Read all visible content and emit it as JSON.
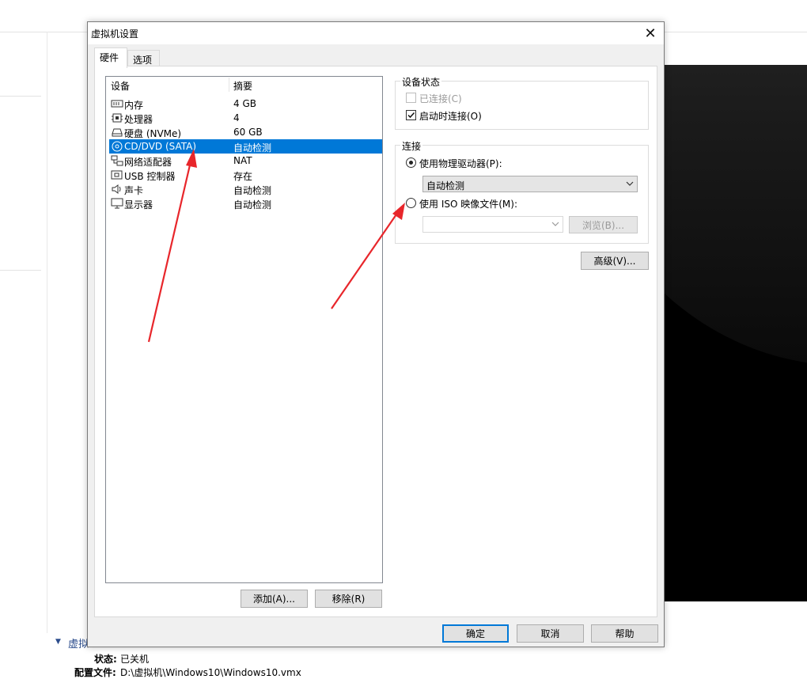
{
  "background": {
    "section_title": "虚拟",
    "status_label": "状态:",
    "status_value": "已关机",
    "config_label": "配置文件:",
    "config_value": "D:\\虚拟机\\Windows10\\Windows10.vmx"
  },
  "dialog": {
    "title": "虚拟机设置",
    "close_glyph": "✕",
    "tabs": [
      {
        "label": "硬件",
        "active": true
      },
      {
        "label": "选项",
        "active": false
      }
    ],
    "device_list": {
      "col_device": "设备",
      "col_summary": "摘要",
      "rows": [
        {
          "name": "内存",
          "summary": "4 GB",
          "icon": "memory-icon",
          "selected": false
        },
        {
          "name": "处理器",
          "summary": "4",
          "icon": "processor-icon",
          "selected": false
        },
        {
          "name": "硬盘 (NVMe)",
          "summary": "60 GB",
          "icon": "hard-disk-icon",
          "selected": false
        },
        {
          "name": "CD/DVD (SATA)",
          "summary": "自动检测",
          "icon": "cd-dvd-icon",
          "selected": true
        },
        {
          "name": "网络适配器",
          "summary": "NAT",
          "icon": "network-adapter-icon",
          "selected": false
        },
        {
          "name": "USB 控制器",
          "summary": "存在",
          "icon": "usb-icon",
          "selected": false
        },
        {
          "name": "声卡",
          "summary": "自动检测",
          "icon": "sound-card-icon",
          "selected": false
        },
        {
          "name": "显示器",
          "summary": "自动检测",
          "icon": "display-icon",
          "selected": false
        }
      ]
    },
    "add_button": "添加(A)...",
    "remove_button": "移除(R)",
    "device_status": {
      "title": "设备状态",
      "connected_label": "已连接(C)",
      "connected_checked": false,
      "connected_disabled": true,
      "connect_at_power_on_label": "启动时连接(O)",
      "connect_at_power_on_checked": true
    },
    "connection": {
      "title": "连接",
      "physical_drive_label": "使用物理驱动器(P):",
      "physical_drive_selected": true,
      "physical_drive_value": "自动检测",
      "iso_label": "使用 ISO 映像文件(M):",
      "iso_selected": false,
      "iso_value": "",
      "browse_button": "浏览(B)..."
    },
    "advanced_button": "高级(V)...",
    "ok_button": "确定",
    "cancel_button": "取消",
    "help_button": "帮助"
  },
  "annotations": {
    "arrow_color": "#e8262b"
  },
  "colors": {
    "selection": "#0078d7",
    "dialog_bg": "#f0f0f0",
    "vm_screen": "#000000"
  }
}
